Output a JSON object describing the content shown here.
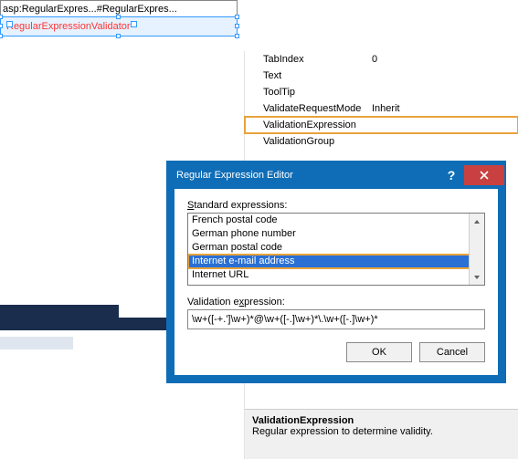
{
  "design": {
    "tag_bar_text": "asp:RegularExpres...#RegularExpres...",
    "validator_text": "RegularExpressionValidator"
  },
  "properties": {
    "rows": [
      {
        "name": "TabIndex",
        "value": "0"
      },
      {
        "name": "Text",
        "value": ""
      },
      {
        "name": "ToolTip",
        "value": ""
      },
      {
        "name": "ValidateRequestMode",
        "value": "Inherit"
      },
      {
        "name": "ValidationExpression",
        "value": ""
      },
      {
        "name": "ValidationGroup",
        "value": ""
      }
    ],
    "highlight_index": 4,
    "desc_title": "ValidationExpression",
    "desc_text": "Regular expression to determine validity."
  },
  "dialog": {
    "title": "Regular Expression Editor",
    "label_standard_prefix": "S",
    "label_standard_rest": "tandard expressions:",
    "items": [
      "French postal code",
      "German phone number",
      "German postal code",
      "Internet e-mail address",
      "Internet URL"
    ],
    "selected_index": 3,
    "label_validation_prefix": "Validation e",
    "label_validation_ul": "x",
    "label_validation_rest": "pression:",
    "expression_value": "\\w+([-+.']\\w+)*@\\w+([-.]\\w+)*\\.\\w+([-.]\\w+)*",
    "ok_label": "OK",
    "cancel_label": "Cancel"
  }
}
